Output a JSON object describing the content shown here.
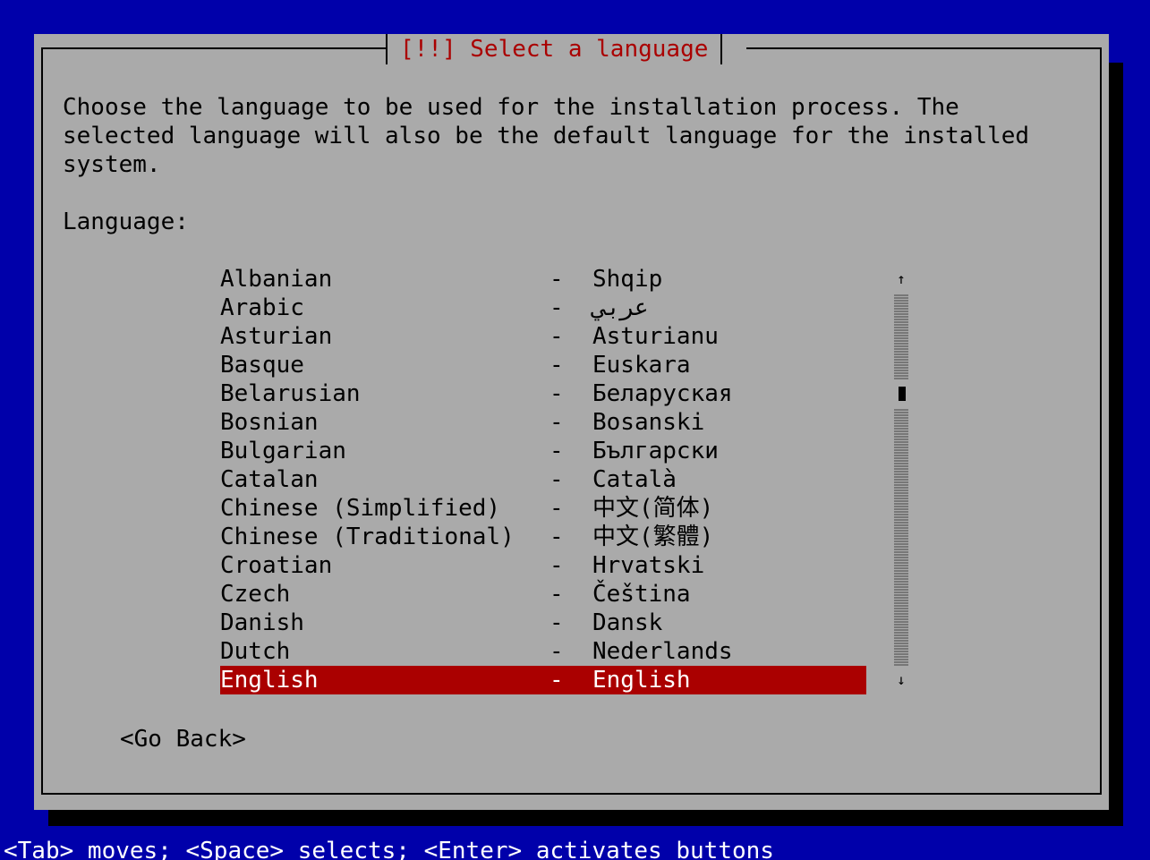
{
  "dialog": {
    "title": "[!!] Select a language",
    "description": "Choose the language to be used for the installation process. The\nselected language will also be the default language for the installed\nsystem.",
    "list_label": "Language:"
  },
  "languages": [
    {
      "name": "Albanian",
      "native": "Shqip"
    },
    {
      "name": "Arabic",
      "native": "عربي"
    },
    {
      "name": "Asturian",
      "native": "Asturianu"
    },
    {
      "name": "Basque",
      "native": "Euskara"
    },
    {
      "name": "Belarusian",
      "native": "Беларуская"
    },
    {
      "name": "Bosnian",
      "native": "Bosanski"
    },
    {
      "name": "Bulgarian",
      "native": "Български"
    },
    {
      "name": "Catalan",
      "native": "Català"
    },
    {
      "name": "Chinese (Simplified)",
      "native": "中文(简体)"
    },
    {
      "name": "Chinese (Traditional)",
      "native": "中文(繁體)"
    },
    {
      "name": "Croatian",
      "native": "Hrvatski"
    },
    {
      "name": "Czech",
      "native": "Čeština"
    },
    {
      "name": "Danish",
      "native": "Dansk"
    },
    {
      "name": "Dutch",
      "native": "Nederlands"
    },
    {
      "name": "English",
      "native": "English",
      "selected": true
    }
  ],
  "separator": "-",
  "scrollbar": {
    "up_arrow": "↑",
    "down_arrow": "↓"
  },
  "buttons": {
    "go_back": "<Go Back>"
  },
  "status_bar": "<Tab> moves; <Space> selects; <Enter> activates buttons",
  "colors": {
    "background": "#0000aa",
    "dialog": "#aaaaaa",
    "title": "#aa0000",
    "selection": "#aa0000",
    "selection_text": "#ffffff"
  }
}
